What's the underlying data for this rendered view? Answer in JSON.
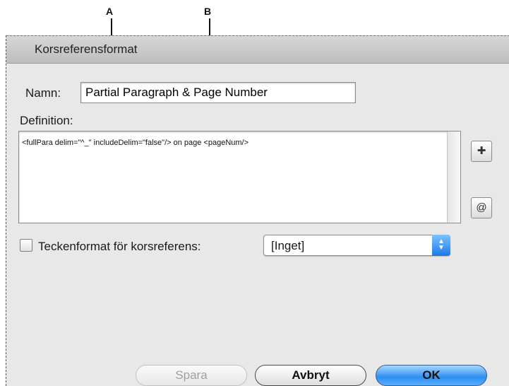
{
  "callouts": {
    "a": "A",
    "b": "B"
  },
  "dialog": {
    "title": "Korsreferensformat",
    "name_label": "Namn:",
    "name_value": "Partial Paragraph & Page Number",
    "definition_label": "Definition:",
    "definition_text": "<fullPara delim=\"^_\" includeDelim=\"false\"/> on page <pageNum/>",
    "insert_building_block_icon": "plus-tag-icon",
    "insert_special_char_icon": "at-sign-icon",
    "char_style_label": "Teckenformat för korsreferens:",
    "char_style_checked": false,
    "char_style_value": "[Inget]",
    "buttons": {
      "save": "Spara",
      "cancel": "Avbryt",
      "ok": "OK"
    }
  },
  "colors": {
    "accent": "#2e8ef0",
    "dialog_bg": "#e8e8e8"
  }
}
